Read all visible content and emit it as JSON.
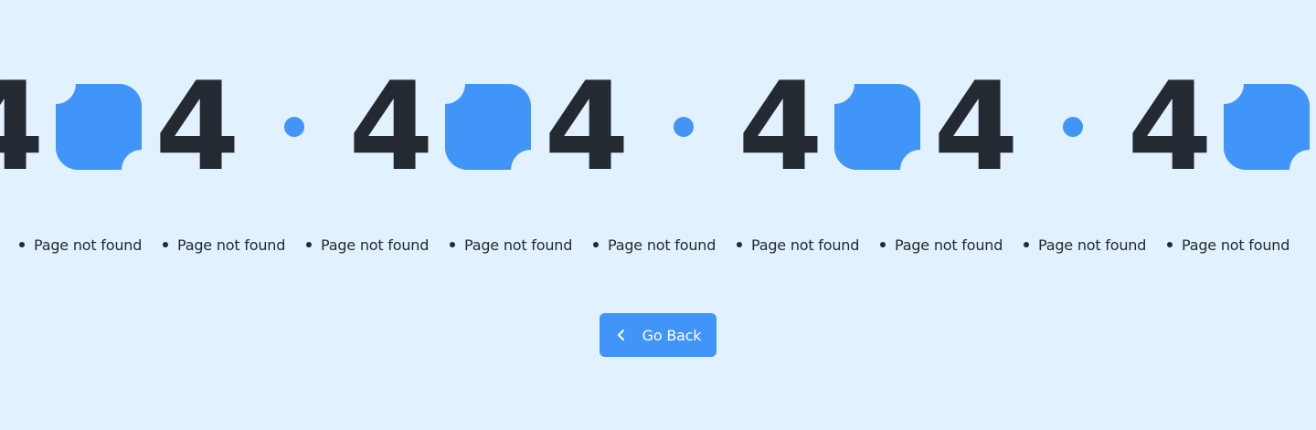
{
  "colors": {
    "background": "#e1f1fe",
    "accent": "#4194f8",
    "text": "#242a31",
    "button_text": "#ffffff"
  },
  "hero": {
    "digit_left": "4",
    "digit_right": "4",
    "zero_icon": "clover-zero-icon",
    "separator_icon": "dot-separator-icon",
    "repeat_count": 4
  },
  "ticker": {
    "text": "Page not found",
    "bullet_icon": "bullet-icon",
    "repeat_count": 10
  },
  "actions": {
    "back_icon": "chevron-left-icon",
    "back_label": "Go Back"
  }
}
